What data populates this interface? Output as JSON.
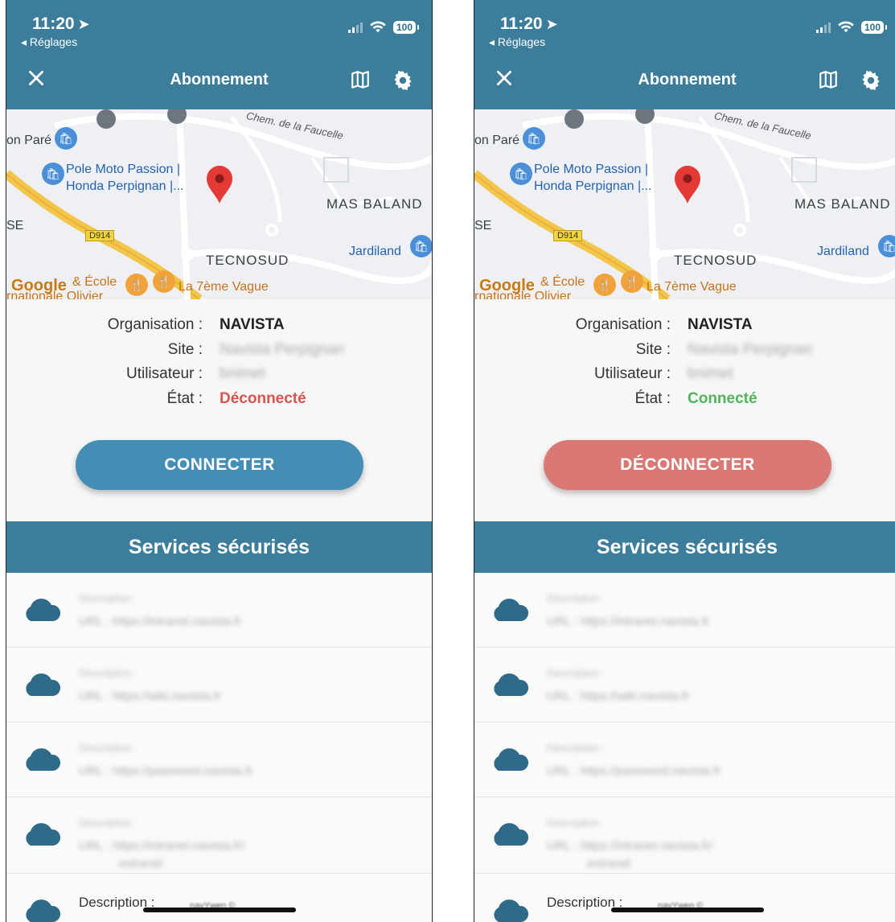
{
  "status": {
    "time": "11:20",
    "back": "◂ Réglages",
    "battery": "100"
  },
  "nav": {
    "title": "Abonnement"
  },
  "map": {
    "labels": {
      "pare": "on Paré",
      "pole": "Pole Moto Passion |",
      "honda": "Honda Perpignan |...",
      "chem": "Chem. de la Faucelle",
      "mas": "MAS BALAND",
      "se": "SE",
      "d914": "D914",
      "tecnosud": "TECNOSUD",
      "jardiland": "Jardiland",
      "ecole": "& École",
      "olivier": "rnationale Olivier",
      "vague": "La 7ème Vague",
      "google": "Google"
    }
  },
  "info": {
    "organisation_label": "Organisation :",
    "organisation_value": "NAVISTA",
    "site_label": "Site :",
    "site_value": "Navista Perpignan",
    "user_label": "Utilisateur :",
    "user_value": "bnimet",
    "state_label": "État :"
  },
  "screens": {
    "left": {
      "state": "Déconnecté",
      "button": "CONNECTER"
    },
    "right": {
      "state": "Connecté",
      "button": "DÉCONNECTER"
    }
  },
  "services": {
    "title": "Services sécurisés",
    "desc_label": "Description :",
    "items": [
      {
        "desc": "Description :",
        "url": "URL : https://intranet.navista.fr",
        "url2": ""
      },
      {
        "desc": "Description :",
        "url": "URL : https://wiki.navista.fr",
        "url2": ""
      },
      {
        "desc": "Description :",
        "url": "URL : https://password.navista.fr",
        "url2": ""
      },
      {
        "desc": "Description :",
        "url": "URL : https://intranet.navista.fr/",
        "url2": "extranet"
      },
      {
        "desc": "Description :",
        "url": "",
        "url2": ""
      }
    ]
  },
  "footer": "navYwen ©",
  "colors": {
    "primary": "#3c7d9b",
    "connect": "#448db5",
    "disconnect": "#d97875",
    "off": "#d9534f",
    "on": "#53b35b"
  }
}
